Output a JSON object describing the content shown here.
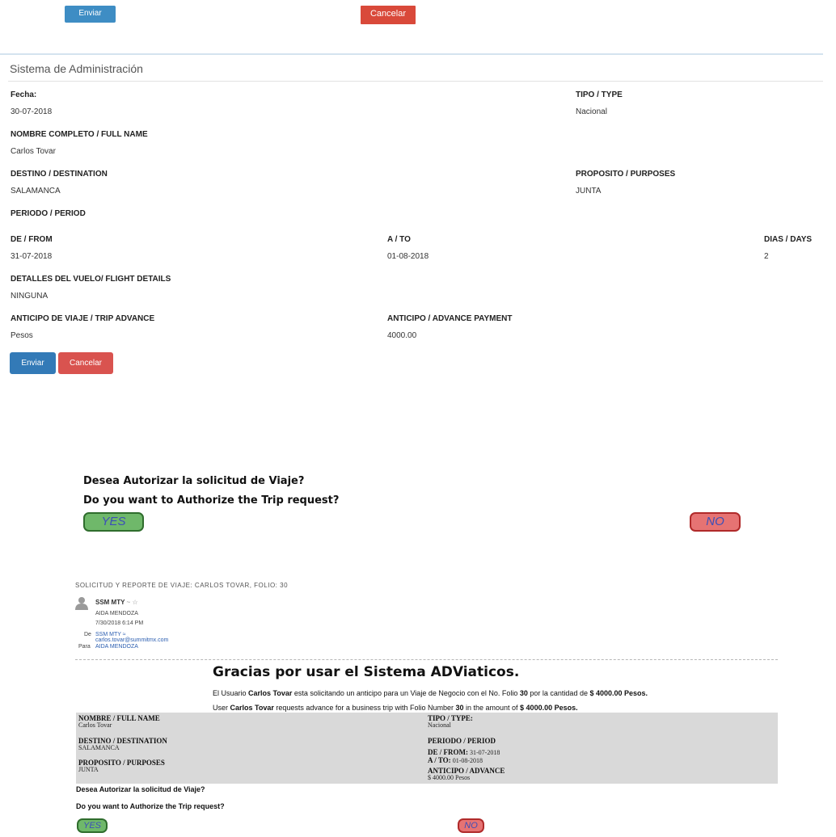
{
  "top_buttons": {
    "send": "Enviar",
    "cancel": "Cancelar"
  },
  "panel": {
    "title": "Sistema de Administración",
    "fields": {
      "fecha_label": "Fecha:",
      "fecha_value": "30-07-2018",
      "tipo_label": "TIPO / TYPE",
      "tipo_value": "Nacional",
      "nombre_label": "NOMBRE COMPLETO / FULL NAME",
      "nombre_value": "Carlos Tovar",
      "destino_label": "DESTINO / DESTINATION",
      "destino_value": "SALAMANCA",
      "proposito_label": "PROPOSITO / PURPOSES",
      "proposito_value": "JUNTA",
      "periodo_label": "PERIODO / PERIOD",
      "de_label": "DE / FROM",
      "de_value": "31-07-2018",
      "a_label": "A / TO",
      "a_value": "01-08-2018",
      "dias_label": "DIAS / DAYS",
      "dias_value": "2",
      "vuelo_label": "DETALLES DEL VUELO/ FLIGHT DETAILS",
      "vuelo_value": "NINGUNA",
      "anticipo_viaje_label": "ANTICIPO DE VIAJE / TRIP ADVANCE",
      "anticipo_viaje_value": "Pesos",
      "anticipo_label": "ANTICIPO / ADVANCE PAYMENT",
      "anticipo_value": "4000.00"
    },
    "send": "Enviar",
    "cancel": "Cancelar"
  },
  "authorize": {
    "question_es": "Desea Autorizar la solicitud de Viaje?",
    "question_en": "Do you want to Authorize the Trip request?",
    "yes": "YES",
    "no": "NO"
  },
  "email": {
    "subject": "SOLICITUD Y REPORTE DE VIAJE: CARLOS TOVAR, FOLIO: 30",
    "sender": "SSM MTY",
    "sender_suffix": "~ ☆",
    "recipient_name": "AIDA MENDOZA",
    "datetime": "7/30/2018 6:14 PM",
    "de_label": "De",
    "de_name": "SSM MTY ≈",
    "de_email": "carlos.tovar@summitmx.com",
    "para_label": "Para",
    "para_name": "AIDA MENDOZA",
    "heading": "Gracias por usar el Sistema ADViaticos.",
    "line_es": {
      "a": "El Usuario ",
      "user": "Carlos Tovar",
      "b": " esta solicitando un anticipo para un Viaje de Negocio con el No. Folio ",
      "folio": "30",
      "c": " por la cantidad de ",
      "amount": "$ 4000.00 Pesos."
    },
    "line_en": {
      "a": "User ",
      "user": "Carlos Tovar",
      "b": " requests advance for a business trip with Folio Number ",
      "folio": "30",
      "c": " in the amount of ",
      "amount": "$ 4000.00 Pesos."
    },
    "table": {
      "nombre_label": "NOMBRE / FULL NAME",
      "nombre_value": "Carlos Tovar",
      "tipo_label": "TIPO / TYPE:",
      "tipo_value": "Nacional",
      "destino_label": "DESTINO / DESTINATION",
      "destino_value": "SALAMANCA",
      "periodo_label": "PERIODO / PERIOD",
      "de_label": "DE / FROM:",
      "de_value": " 31-07-2018",
      "a_label": "A / TO:",
      "a_value": " 01-08-2018",
      "proposito_label": "PROPOSITO / PURPOSES",
      "proposito_value": "JUNTA",
      "anticipo_label": "ANTICIPO / ADVANCE",
      "anticipo_value": "$ 4000.00 Pesos"
    },
    "question_es": "Desea Autorizar la solicitud de Viaje?",
    "question_en": "Do you want to Authorize the Trip request?",
    "yes": "YES",
    "no": "NO"
  }
}
